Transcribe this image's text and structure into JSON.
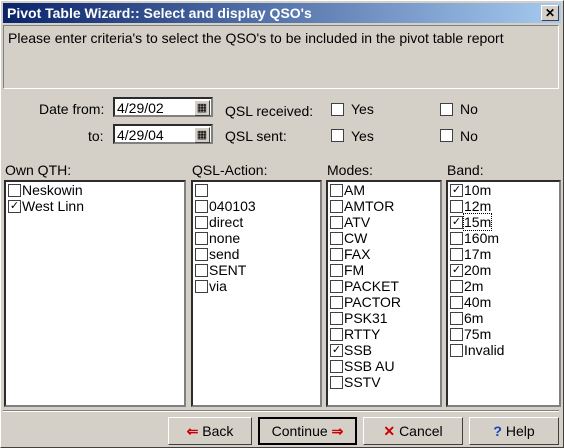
{
  "window": {
    "title": "Pivot Table Wizard:: Select and display QSO's",
    "close_glyph": "✕"
  },
  "message": "Please enter criteria's to select the QSO's to be included in the pivot table report",
  "dates": {
    "from_label": "Date from:",
    "from_value": "4/29/02",
    "to_label": "to:",
    "to_value": "4/29/04",
    "picker_glyph": "▦"
  },
  "qsl": {
    "received_label": "QSL received:",
    "sent_label": "QSL sent:",
    "yes_label": "Yes",
    "no_label": "No"
  },
  "columns": {
    "own_qth": {
      "label": "Own QTH:",
      "items": [
        {
          "text": "Neskowin",
          "checked": false
        },
        {
          "text": "West Linn",
          "checked": true
        }
      ]
    },
    "qsl_action": {
      "label": "QSL-Action:",
      "items": [
        {
          "text": "",
          "checked": false
        },
        {
          "text": "040103",
          "checked": false
        },
        {
          "text": "direct",
          "checked": false
        },
        {
          "text": "none",
          "checked": false
        },
        {
          "text": "send",
          "checked": false
        },
        {
          "text": "SENT",
          "checked": false
        },
        {
          "text": "via",
          "checked": false
        }
      ]
    },
    "modes": {
      "label": "Modes:",
      "items": [
        {
          "text": "AM",
          "checked": false
        },
        {
          "text": "AMTOR",
          "checked": false
        },
        {
          "text": "ATV",
          "checked": false
        },
        {
          "text": "CW",
          "checked": false
        },
        {
          "text": "FAX",
          "checked": false
        },
        {
          "text": "FM",
          "checked": false
        },
        {
          "text": "PACKET",
          "checked": false
        },
        {
          "text": "PACTOR",
          "checked": false
        },
        {
          "text": "PSK31",
          "checked": false
        },
        {
          "text": "RTTY",
          "checked": false
        },
        {
          "text": "SSB",
          "checked": true
        },
        {
          "text": "SSB AU",
          "checked": false
        },
        {
          "text": "SSTV",
          "checked": false
        }
      ]
    },
    "band": {
      "label": "Band:",
      "items": [
        {
          "text": "10m",
          "checked": true
        },
        {
          "text": "12m",
          "checked": false
        },
        {
          "text": "15m",
          "checked": true,
          "focused": true
        },
        {
          "text": "160m",
          "checked": false
        },
        {
          "text": "17m",
          "checked": false
        },
        {
          "text": "20m",
          "checked": true
        },
        {
          "text": "2m",
          "checked": false
        },
        {
          "text": "40m",
          "checked": false
        },
        {
          "text": "6m",
          "checked": false
        },
        {
          "text": "75m",
          "checked": false
        },
        {
          "text": "Invalid",
          "checked": false
        }
      ]
    }
  },
  "buttons": {
    "back_label": "Back",
    "back_icon": "⇐",
    "continue_label": "Continue",
    "continue_icon": "⇒",
    "cancel_label": "Cancel",
    "cancel_icon": "✕",
    "help_label": "Help",
    "help_icon": "?"
  },
  "colors": {
    "title_gradient_start": "#0a246a",
    "title_gradient_end": "#a6caf0",
    "arrow_red": "#cc0000",
    "help_blue": "#1a3fb8"
  }
}
